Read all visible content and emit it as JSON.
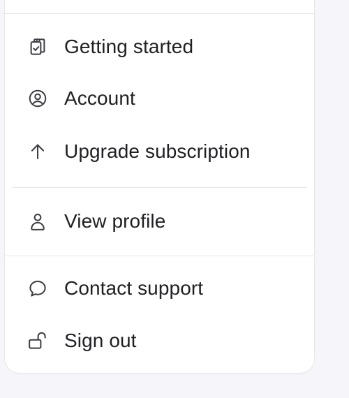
{
  "menu": {
    "items": [
      {
        "label": "Getting started",
        "icon": "clipboard-check-icon"
      },
      {
        "label": "Account",
        "icon": "user-circle-icon"
      },
      {
        "label": "Upgrade subscription",
        "icon": "arrow-up-icon"
      },
      {
        "label": "View profile",
        "icon": "user-icon"
      },
      {
        "label": "Contact support",
        "icon": "chat-bubble-icon"
      },
      {
        "label": "Sign out",
        "icon": "unlock-icon"
      }
    ]
  },
  "colors": {
    "background": "#f6f6fa",
    "panel": "#ffffff",
    "divider": "#e6e6ea",
    "text": "#202024",
    "icon": "#3b3b42"
  }
}
